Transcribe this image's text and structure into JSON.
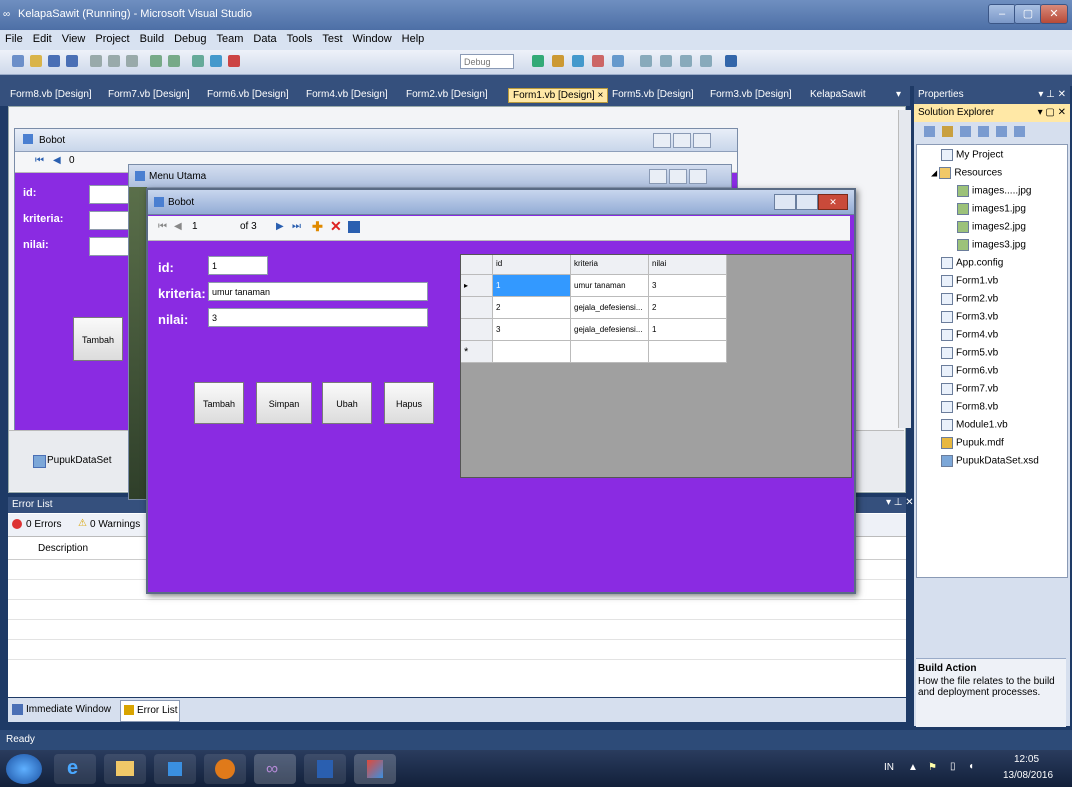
{
  "window": {
    "title": "KelapaSawit (Running) - Microsoft Visual Studio"
  },
  "menu": [
    "File",
    "Edit",
    "View",
    "Project",
    "Build",
    "Debug",
    "Team",
    "Data",
    "Tools",
    "Test",
    "Window",
    "Help"
  ],
  "toolbar": {
    "config": "Debug"
  },
  "doc_tabs": [
    "Form8.vb [Design]",
    "Form7.vb [Design]",
    "Form6.vb [Design]",
    "Form4.vb [Design]",
    "Form2.vb [Design]",
    "Form1.vb [Design]",
    "Form5.vb [Design]",
    "Form3.vb [Design]",
    "KelapaSawit"
  ],
  "active_tab_close": "×",
  "designer_form": {
    "title": "Bobot",
    "nav_position": "0",
    "labels": {
      "id": "id:",
      "kriteria": "kriteria:",
      "nilai": "nilai:"
    },
    "button_tambah": "Tambah",
    "component_tray": "PupukDataSet"
  },
  "menu_utama": {
    "title": "Menu Utama"
  },
  "bobot_runtime": {
    "title": "Bobot",
    "nav": {
      "position": "1",
      "count": "of 3"
    },
    "labels": {
      "id": "id:",
      "kriteria": "kriteria:",
      "nilai": "nilai:"
    },
    "values": {
      "id": "1",
      "kriteria": "umur tanaman",
      "nilai": "3"
    },
    "buttons": {
      "tambah": "Tambah",
      "simpan": "Simpan",
      "ubah": "Ubah",
      "hapus": "Hapus"
    },
    "grid": {
      "columns": [
        "id",
        "kriteria",
        "nilai"
      ],
      "rows": [
        [
          "1",
          "umur tanaman",
          "3"
        ],
        [
          "2",
          "gejala_defesiensi...",
          "2"
        ],
        [
          "3",
          "gejala_defesiensi...",
          "1"
        ]
      ],
      "new_row_marker": "*",
      "current_row_marker": "▸"
    }
  },
  "error_list": {
    "title": "Error List",
    "errors": "0 Errors",
    "warnings": "0 Warnings",
    "column": "Description"
  },
  "bottom_tabs": [
    "Immediate Window",
    "Error List"
  ],
  "status": "Ready",
  "properties": {
    "title": "Properties"
  },
  "solution_explorer": {
    "title": "Solution Explorer",
    "items": [
      "My Project",
      "Resources",
      "images.....jpg",
      "images1.jpg",
      "images2.jpg",
      "images3.jpg",
      "App.config",
      "Form1.vb",
      "Form2.vb",
      "Form3.vb",
      "Form4.vb",
      "Form5.vb",
      "Form6.vb",
      "Form7.vb",
      "Form8.vb",
      "Module1.vb",
      "Pupuk.mdf",
      "PupukDataSet.xsd"
    ]
  },
  "build_action": {
    "title": "Build Action",
    "desc": "How the file relates to the build and deployment processes."
  },
  "tray": {
    "lang": "IN",
    "time": "12:05",
    "date": "13/08/2016"
  }
}
